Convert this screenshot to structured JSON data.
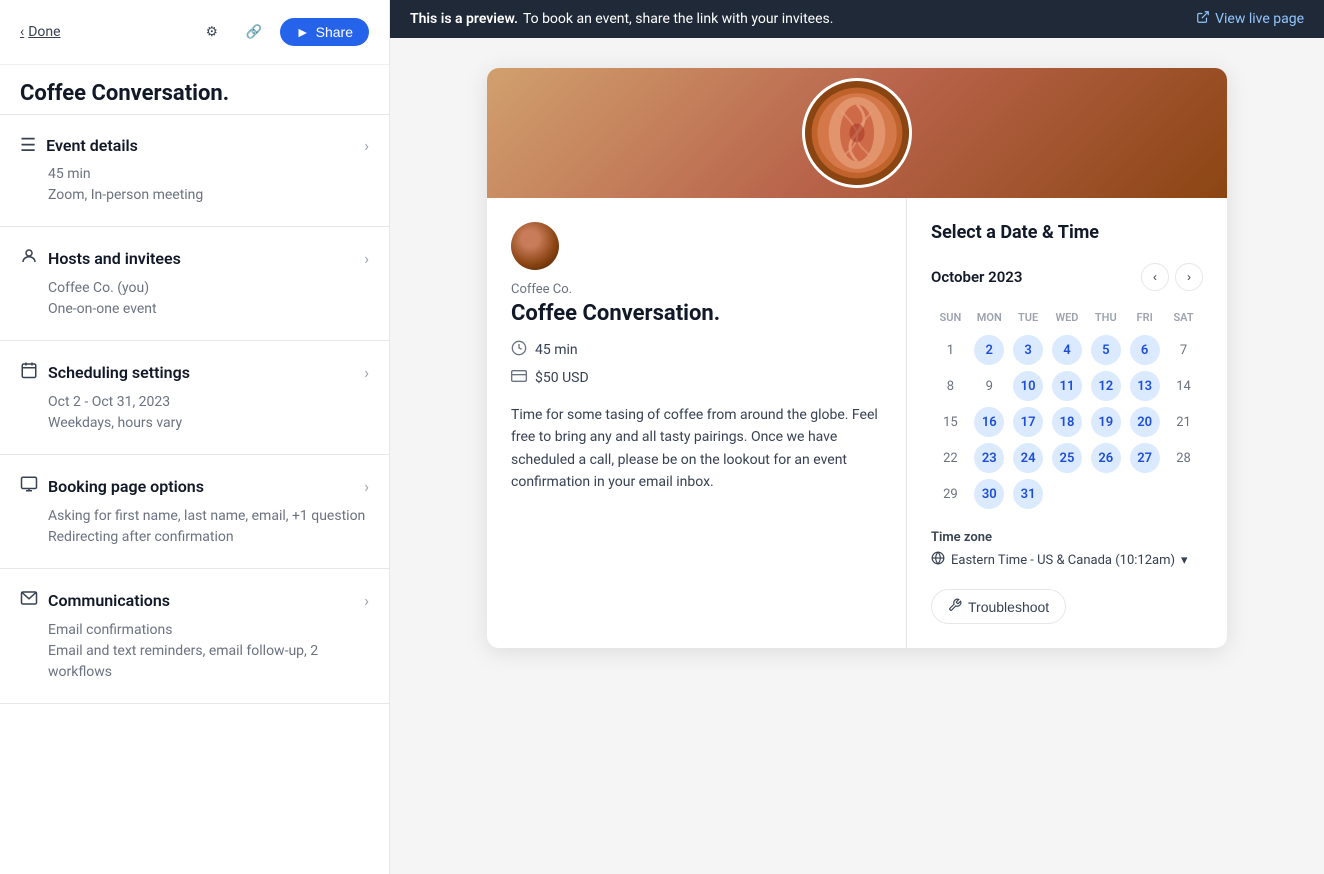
{
  "sidebar": {
    "back_label": "Done",
    "event_title": "Coffee Conversation.",
    "icons": {
      "settings": "⚙",
      "link": "🔗",
      "share": "Share"
    },
    "sections": [
      {
        "id": "event-details",
        "icon": "☰",
        "title": "Event details",
        "details": [
          "45 min",
          "Zoom, In-person meeting"
        ]
      },
      {
        "id": "hosts-invitees",
        "icon": "👤",
        "title": "Hosts and invitees",
        "details": [
          "Coffee Co. (you)",
          "One-on-one event"
        ]
      },
      {
        "id": "scheduling-settings",
        "icon": "📅",
        "title": "Scheduling settings",
        "details": [
          "Oct 2 - Oct 31, 2023",
          "Weekdays, hours vary"
        ]
      },
      {
        "id": "booking-page-options",
        "icon": "🖥",
        "title": "Booking page options",
        "details": [
          "Asking for first name, last name, email, +1 question",
          "Redirecting after confirmation"
        ]
      },
      {
        "id": "communications",
        "icon": "✉",
        "title": "Communications",
        "details": [
          "Email confirmations",
          "Email and text reminders, email follow-up, 2 workflows"
        ]
      }
    ]
  },
  "preview": {
    "banner": {
      "prefix": "This is a preview.",
      "suffix": "To book an event, share the link with your invitees.",
      "live_link": "View live page"
    },
    "event": {
      "host": "Coffee Co.",
      "name": "Coffee Conversation.",
      "duration": "45 min",
      "price": "$50 USD",
      "description": "Time for some tasing of coffee from around the globe. Feel free to bring any and all tasty pairings. Once we have scheduled a call, please be on the lookout for an event confirmation in your email inbox."
    },
    "calendar": {
      "title": "Select a Date & Time",
      "month": "October 2023",
      "days_of_week": [
        "SUN",
        "MON",
        "TUE",
        "WED",
        "THU",
        "FRI",
        "SAT"
      ],
      "weeks": [
        [
          {
            "day": 1,
            "state": "inactive"
          },
          {
            "day": 2,
            "state": "available"
          },
          {
            "day": 3,
            "state": "available"
          },
          {
            "day": 4,
            "state": "available"
          },
          {
            "day": 5,
            "state": "available"
          },
          {
            "day": 6,
            "state": "available"
          },
          {
            "day": 7,
            "state": "inactive"
          }
        ],
        [
          {
            "day": 8,
            "state": "inactive"
          },
          {
            "day": 9,
            "state": "inactive"
          },
          {
            "day": 10,
            "state": "available"
          },
          {
            "day": 11,
            "state": "available"
          },
          {
            "day": 12,
            "state": "available"
          },
          {
            "day": 13,
            "state": "available"
          },
          {
            "day": 14,
            "state": "inactive"
          }
        ],
        [
          {
            "day": 15,
            "state": "inactive"
          },
          {
            "day": 16,
            "state": "available"
          },
          {
            "day": 17,
            "state": "available"
          },
          {
            "day": 18,
            "state": "available"
          },
          {
            "day": 19,
            "state": "available"
          },
          {
            "day": 20,
            "state": "available"
          },
          {
            "day": 21,
            "state": "inactive"
          }
        ],
        [
          {
            "day": 22,
            "state": "inactive"
          },
          {
            "day": 23,
            "state": "available"
          },
          {
            "day": 24,
            "state": "available"
          },
          {
            "day": 25,
            "state": "available"
          },
          {
            "day": 26,
            "state": "available"
          },
          {
            "day": 27,
            "state": "available"
          },
          {
            "day": 28,
            "state": "inactive"
          }
        ],
        [
          {
            "day": 29,
            "state": "inactive"
          },
          {
            "day": 30,
            "state": "available"
          },
          {
            "day": 31,
            "state": "available"
          },
          {
            "day": "",
            "state": "empty"
          },
          {
            "day": "",
            "state": "empty"
          },
          {
            "day": "",
            "state": "empty"
          },
          {
            "day": "",
            "state": "empty"
          }
        ]
      ],
      "timezone_label": "Time zone",
      "timezone_value": "Eastern Time - US & Canada (10:12am)",
      "troubleshoot_label": "Troubleshoot"
    }
  }
}
